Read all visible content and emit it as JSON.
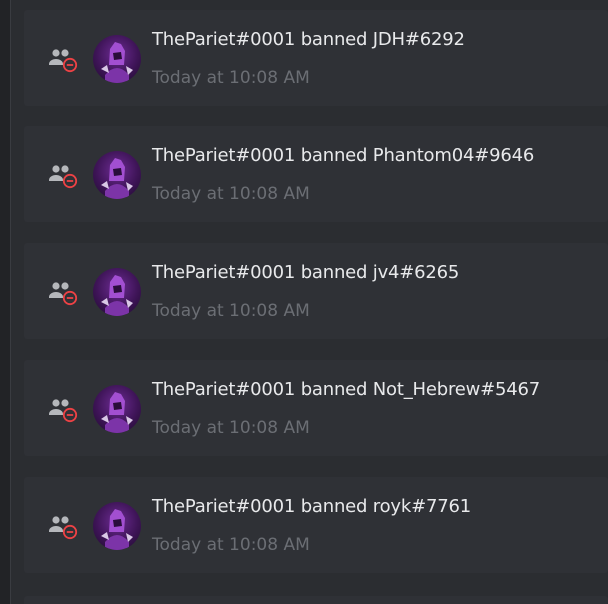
{
  "audit_log": {
    "entries": [
      {
        "action_text": "ThePariet#0001 banned JDH#6292",
        "timestamp": "Today at 10:08 AM",
        "icon": "member-remove-icon",
        "avatar": "user-avatar"
      },
      {
        "action_text": "ThePariet#0001 banned Phantom04#9646",
        "timestamp": "Today at 10:08 AM",
        "icon": "member-remove-icon",
        "avatar": "user-avatar"
      },
      {
        "action_text": "ThePariet#0001 banned jv4#6265",
        "timestamp": "Today at 10:08 AM",
        "icon": "member-remove-icon",
        "avatar": "user-avatar"
      },
      {
        "action_text": "ThePariet#0001 banned Not_Hebrew#5467",
        "timestamp": "Today at 10:08 AM",
        "icon": "member-remove-icon",
        "avatar": "user-avatar"
      },
      {
        "action_text": "ThePariet#0001 banned royk#7761",
        "timestamp": "Today at 10:08 AM",
        "icon": "member-remove-icon",
        "avatar": "user-avatar"
      }
    ]
  },
  "colors": {
    "background": "#2b2d31",
    "entry_background": "#2f3136",
    "primary_text": "#e8e9eb",
    "muted_text": "#6b6e74",
    "icon_gray": "#b5b7bb",
    "ban_red": "#ed4245",
    "avatar_purple": "#6d2c93"
  }
}
